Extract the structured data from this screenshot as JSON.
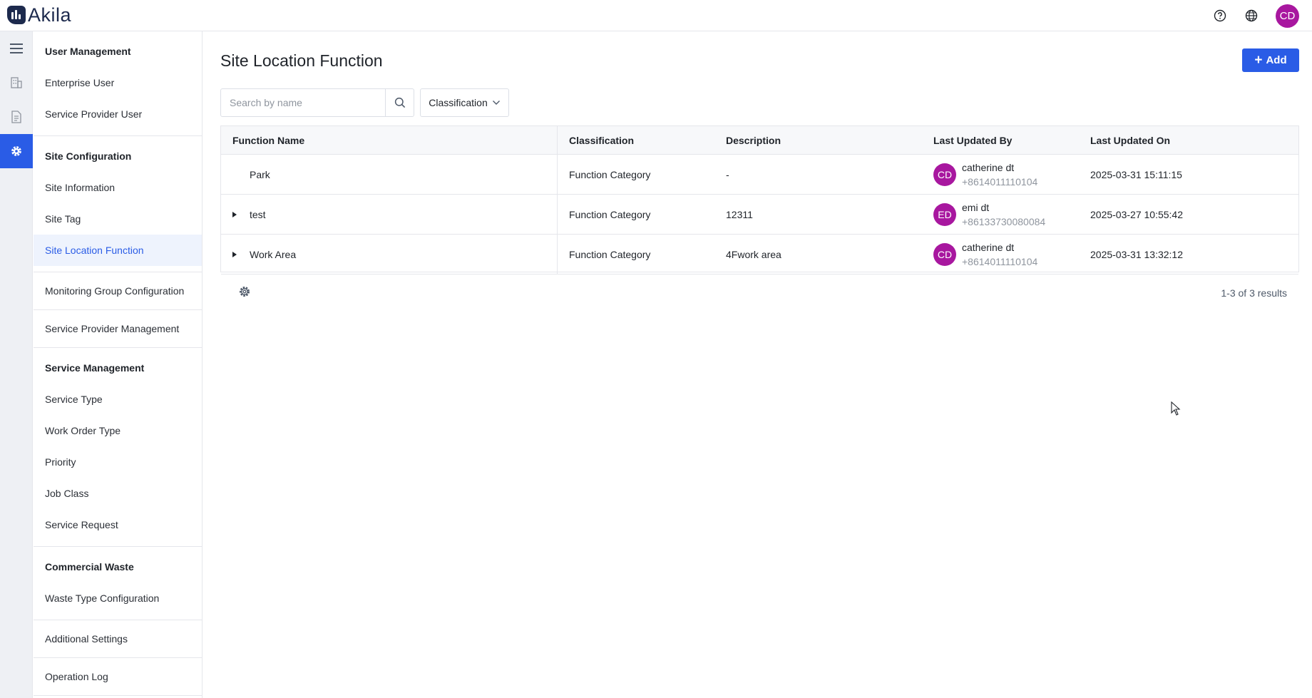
{
  "app": {
    "logo_text": "Akila"
  },
  "header": {
    "user_initials": "CD",
    "icons": [
      "help-icon",
      "globe-icon"
    ]
  },
  "rail": {
    "icons": [
      "menu-icon",
      "building-icon",
      "document-icon",
      "gear-icon"
    ],
    "active": "gear-icon"
  },
  "sidebar": {
    "groups": [
      {
        "title": "User Management",
        "items": [
          "Enterprise User",
          "Service Provider User"
        ]
      },
      {
        "title": "Site Configuration",
        "items": [
          "Site Information",
          "Site Tag",
          "Site Location Function"
        ],
        "active": "Site Location Function"
      }
    ],
    "monitoring": "Monitoring Group Configuration",
    "provider_mgmt": "Service Provider Management",
    "service_group": {
      "title": "Service Management",
      "items": [
        "Service Type",
        "Work Order Type",
        "Priority",
        "Job Class",
        "Service Request"
      ]
    },
    "waste_group": {
      "title": "Commercial Waste",
      "items": [
        "Waste Type Configuration"
      ]
    },
    "additional": "Additional Settings",
    "oplog": "Operation Log"
  },
  "page": {
    "title": "Site Location Function",
    "add_label": "Add",
    "search_placeholder": "Search by name",
    "filter_label": "Classification"
  },
  "table": {
    "columns": [
      "Function Name",
      "Classification",
      "Description",
      "Last Updated By",
      "Last Updated On"
    ],
    "rows": [
      {
        "name": "Park",
        "expandable": false,
        "classification": "Function Category",
        "description": "-",
        "initials": "CD",
        "user": "catherine dt",
        "phone": "+8614011110104",
        "updated": "2025-03-31 15:11:15"
      },
      {
        "name": "test",
        "expandable": true,
        "classification": "Function Category",
        "description": "12311",
        "initials": "ED",
        "user": "emi dt",
        "phone": "+86133730080084",
        "updated": "2025-03-27 10:55:42"
      },
      {
        "name": "Work Area",
        "expandable": true,
        "classification": "Function Category",
        "description": "4Fwork area",
        "initials": "CD",
        "user": "catherine dt",
        "phone": "+8614011110104",
        "updated": "2025-03-31 13:32:12"
      }
    ],
    "results_text": "1-3 of 3 results"
  },
  "colors": {
    "accent": "#2a5ce6",
    "avatar": "#a8179f",
    "brand": "#1d2a4d"
  }
}
